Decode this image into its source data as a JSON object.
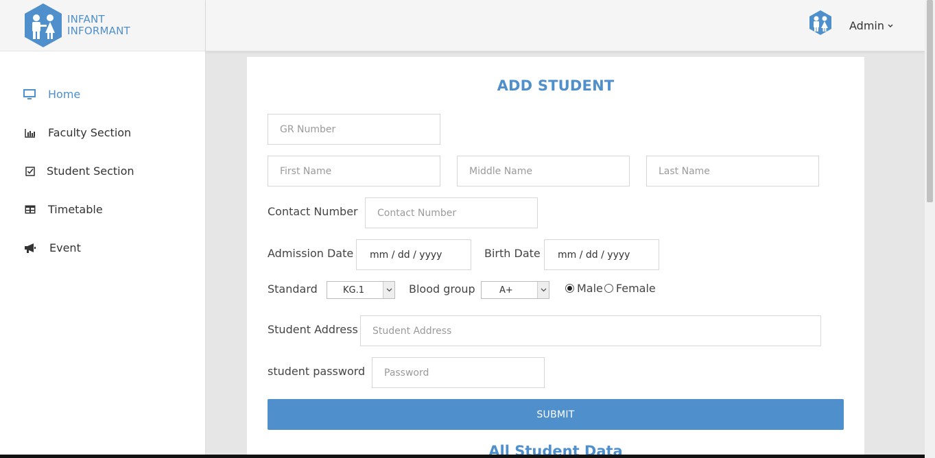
{
  "brand": {
    "line1": "INFANT",
    "line2": "INFORMANT",
    "color": "#4e8fcc"
  },
  "sidebar": {
    "items": [
      {
        "label": "Home",
        "icon": "monitor-icon",
        "active": true
      },
      {
        "label": "Faculty Section",
        "icon": "bar-chart-icon",
        "active": false
      },
      {
        "label": "Student Section",
        "icon": "checkbox-icon",
        "active": false
      },
      {
        "label": "Timetable",
        "icon": "table-icon",
        "active": false
      },
      {
        "label": "Event",
        "icon": "megaphone-icon",
        "active": false
      }
    ]
  },
  "header": {
    "user_label": "Admin",
    "avatar_icon": "children-avatar-icon",
    "dropdown_icon": "chevron-down-icon"
  },
  "form": {
    "title": "ADD STUDENT",
    "gr_number": {
      "placeholder": "GR Number",
      "value": ""
    },
    "first_name": {
      "placeholder": "First Name",
      "value": ""
    },
    "middle_name": {
      "placeholder": "Middle Name",
      "value": ""
    },
    "last_name": {
      "placeholder": "Last Name",
      "value": ""
    },
    "contact_number": {
      "label": "Contact Number",
      "placeholder": "Contact Number",
      "value": ""
    },
    "admission_date": {
      "label": "Admission Date",
      "value": "mm / dd / yyyy"
    },
    "birth_date": {
      "label": "Birth Date",
      "value": "mm / dd / yyyy"
    },
    "standard": {
      "label": "Standard",
      "value": "KG.1"
    },
    "blood_group": {
      "label": "Blood group",
      "value": "A+"
    },
    "gender": {
      "options": [
        "Male",
        "Female"
      ],
      "selected": "Male"
    },
    "address": {
      "label": "Student Address",
      "placeholder": "Student Address",
      "value": ""
    },
    "password": {
      "label": "student password",
      "placeholder": "Password",
      "value": ""
    },
    "submit_label": "SUBMIT"
  },
  "section_heading": "All Student Data",
  "colors": {
    "accent": "#4e8fcc",
    "background": "#e6e6e6"
  }
}
